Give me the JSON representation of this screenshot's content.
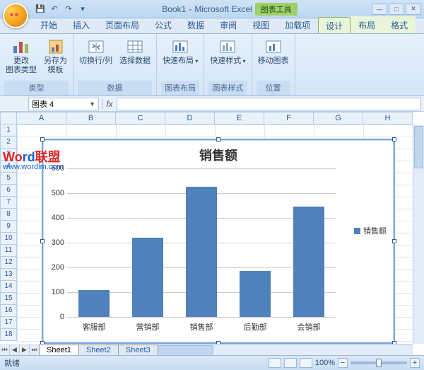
{
  "title": {
    "doc": "Book1",
    "app": "Microsoft Excel",
    "sep": " - ",
    "chart_tools": "图表工具"
  },
  "qat": {
    "save": "save-icon",
    "undo": "undo-icon",
    "redo": "redo-icon"
  },
  "tabs": {
    "items": [
      "开始",
      "插入",
      "页面布局",
      "公式",
      "数据",
      "审阅",
      "视图",
      "加载项"
    ],
    "ctx": [
      "设计",
      "布局",
      "格式"
    ],
    "active": "设计"
  },
  "ribbon": {
    "groups": [
      {
        "label": "类型",
        "buttons": [
          {
            "name": "change-chart-type",
            "label": "更改\n图表类型",
            "icon": "bars-colored"
          },
          {
            "name": "save-as-template",
            "label": "另存为\n模板",
            "icon": "template"
          }
        ]
      },
      {
        "label": "数据",
        "buttons": [
          {
            "name": "switch-row-col",
            "label": "切换行/列",
            "icon": "switch"
          },
          {
            "name": "select-data",
            "label": "选择数据",
            "icon": "grid"
          }
        ]
      },
      {
        "label": "图表布局",
        "buttons": [
          {
            "name": "quick-layout",
            "label": "快速布局",
            "icon": "layout",
            "drop": true
          }
        ]
      },
      {
        "label": "图表样式",
        "buttons": [
          {
            "name": "quick-styles",
            "label": "快速样式",
            "icon": "styles",
            "drop": true
          }
        ]
      },
      {
        "label": "位置",
        "buttons": [
          {
            "name": "move-chart",
            "label": "移动图表",
            "icon": "move"
          }
        ]
      }
    ]
  },
  "namebox": "图表 4",
  "columns": [
    "A",
    "B",
    "C",
    "D",
    "E",
    "F",
    "G",
    "H"
  ],
  "rows": 18,
  "sheets": [
    "Sheet1",
    "Sheet2",
    "Sheet3"
  ],
  "active_sheet": "Sheet1",
  "status": {
    "ready": "就绪",
    "zoom": "100%"
  },
  "watermark": {
    "a": "Wo",
    "b": "rd",
    "c": "联盟",
    "url": "www.wordlm.com"
  },
  "chart_data": {
    "type": "bar",
    "title": "销售额",
    "categories": [
      "客服部",
      "营销部",
      "销售部",
      "后勤部",
      "会销部"
    ],
    "series": [
      {
        "name": "销售额",
        "values": [
          110,
          320,
          525,
          185,
          445
        ]
      }
    ],
    "ylim": [
      0,
      600
    ],
    "yticks": [
      0,
      100,
      200,
      300,
      400,
      500,
      600
    ],
    "legend": "销售额",
    "color": "#4f81bd"
  }
}
